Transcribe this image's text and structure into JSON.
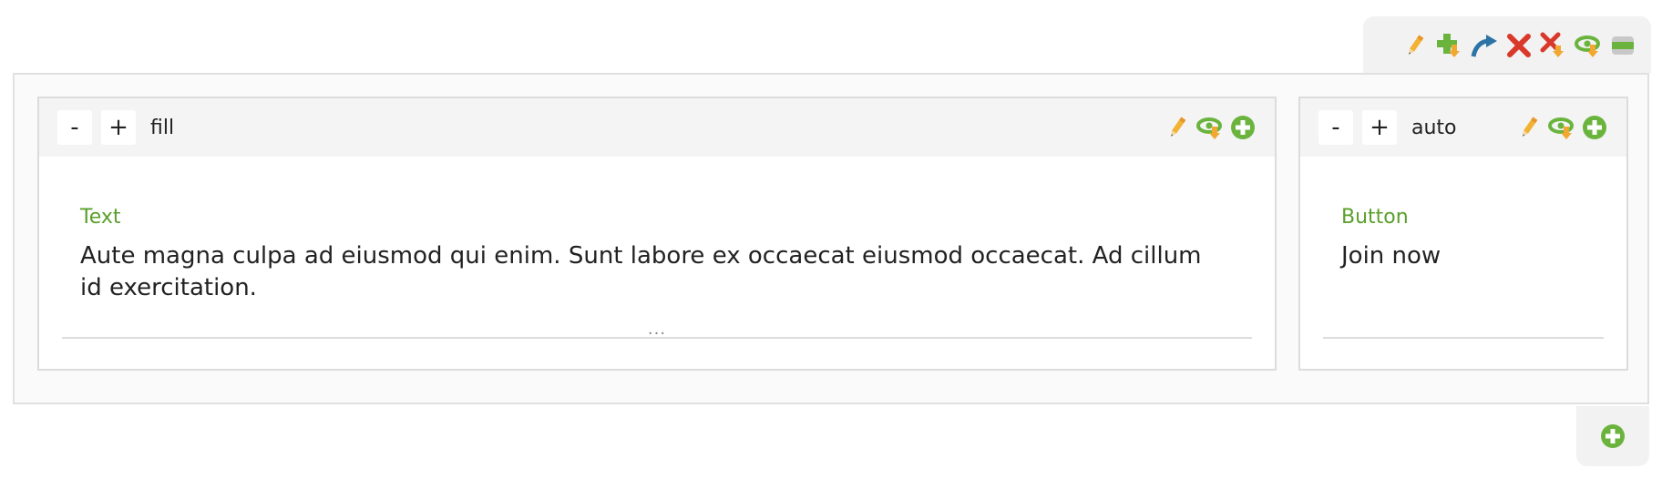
{
  "toolbar": {
    "icons": [
      "pencil-icon",
      "add-below-icon",
      "move-up-icon",
      "delete-icon",
      "delete-below-icon",
      "visibility-icon",
      "collapse-icon"
    ]
  },
  "columns": [
    {
      "size_label": "fill",
      "minus_label": "-",
      "plus_label": "+",
      "block": {
        "type": "Text",
        "body": "Aute magna culpa ad eiusmod qui enim. Sunt labore ex occaecat eiusmod occaecat. Ad cillum id exercitation.",
        "more": "..."
      }
    },
    {
      "size_label": "auto",
      "minus_label": "-",
      "plus_label": "+",
      "block": {
        "type": "Button",
        "body": "Join now"
      }
    }
  ],
  "colors": {
    "accent_green": "#5aa02c",
    "pencil_orange": "#f0a830",
    "delete_red": "#d9392b",
    "move_blue": "#2d74a6"
  }
}
